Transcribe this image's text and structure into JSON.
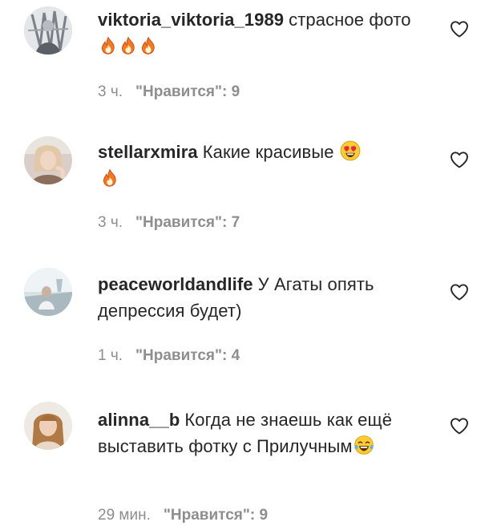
{
  "comments": [
    {
      "username": "viktoria_viktoria_1989",
      "text": "страсное фото",
      "emojis": [
        "fire-emoji",
        "fire-emoji",
        "fire-emoji"
      ],
      "time": "3 ч.",
      "likes_label": "\"Нравится\": 9"
    },
    {
      "username": "stellarxmira",
      "text": "Какие красивые",
      "emojis": [
        "heart-eyes-emoji",
        "fire-emoji"
      ],
      "time": "3 ч.",
      "likes_label": "\"Нравится\": 7"
    },
    {
      "username": "peaceworldandlife",
      "text": "У Агаты опять депрессия будет)",
      "emojis": [],
      "time": "1 ч.",
      "likes_label": "\"Нравится\": 4"
    },
    {
      "username": "alinna__b",
      "text": "Когда не знаешь как ещё выставить фотку с Прилучным",
      "emojis": [
        "tears-of-joy-emoji"
      ],
      "time": "29 мин.",
      "likes_label": "\"Нравится\": 9"
    }
  ],
  "icons": {
    "like": "heart-outline-icon"
  },
  "colors": {
    "text": "#262626",
    "meta": "#8e8e8e",
    "fire": "#f5781f",
    "emoji_face": "#ffcc33"
  }
}
